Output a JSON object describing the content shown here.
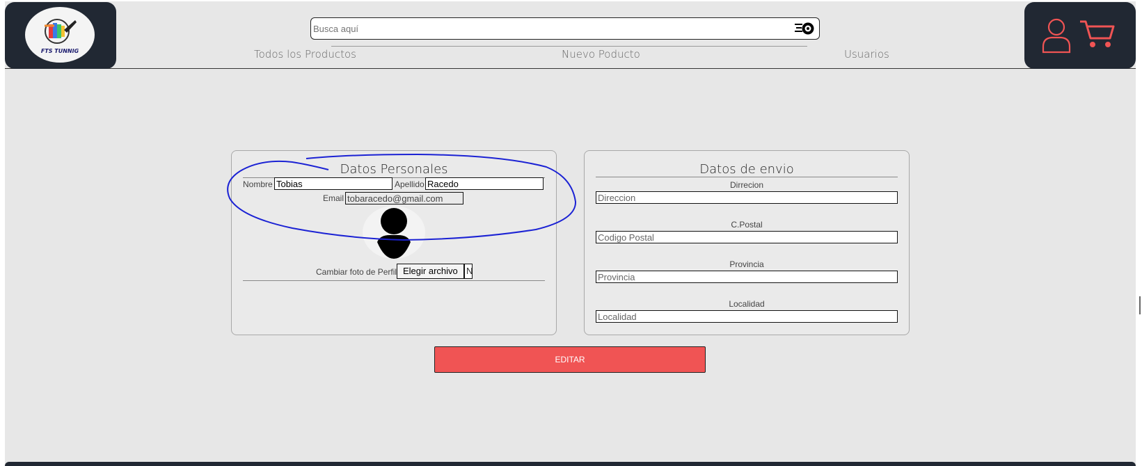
{
  "brand": {
    "logo_text": "FTS TUNNIG"
  },
  "search": {
    "placeholder": "Busca aquí"
  },
  "nav": [
    "Todos los Productos",
    "Nuevo Poducto",
    "Usuarios"
  ],
  "colors": {
    "dark": "#212833",
    "accent": "#f05454",
    "background": "#e7e7e7"
  },
  "icons": {
    "search": "speed-wheel-icon",
    "user": "user-icon",
    "cart": "cart-icon"
  },
  "personal": {
    "title": "Datos Personales",
    "nombre_label": "Nombre",
    "nombre_value": "Tobias",
    "apellido_label": "Apellido",
    "apellido_value": "Racedo",
    "email_label": "Email",
    "email_value": "tobaracedo@gmail.com",
    "photo_label": "Cambiar foto de Perfil",
    "file_button": "Elegir archivo",
    "file_status": "N"
  },
  "shipping": {
    "title": "Datos de envio",
    "fields": [
      {
        "label": "Dirrecion",
        "placeholder": "Direccion"
      },
      {
        "label": "C.Postal",
        "placeholder": "Codigo Postal"
      },
      {
        "label": "Provincia",
        "placeholder": "Provincia"
      },
      {
        "label": "Localidad",
        "placeholder": "Localidad"
      }
    ]
  },
  "edit_button": "EDITAR"
}
